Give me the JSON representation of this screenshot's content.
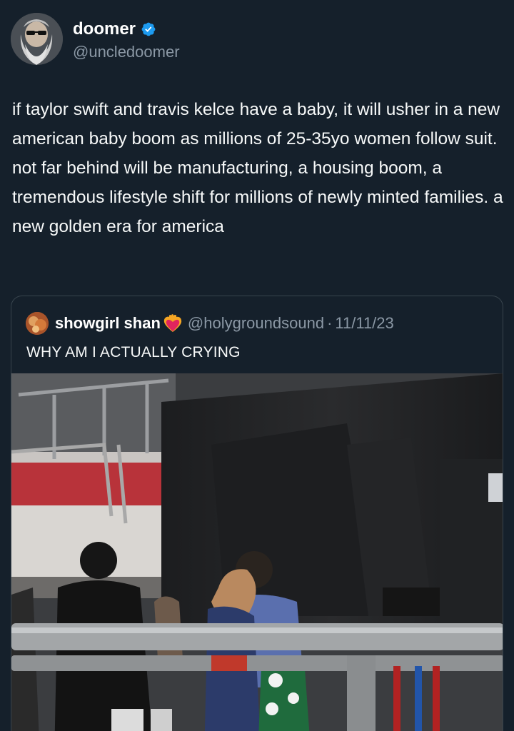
{
  "tweet": {
    "author": {
      "display_name": "doomer",
      "handle": "@uncledoomer",
      "verified": true,
      "verified_color": "#1d9bf0"
    },
    "text": "if taylor swift and travis kelce have a baby, it will usher in a new american baby boom as millions of 25-35yo women follow suit. not far behind will be manufacturing, a housing boom, a tremendous lifestyle shift for millions of newly minted families. a new golden era for america"
  },
  "quote": {
    "display_name": "showgirl shan",
    "name_emoji": "heart-on-fire-icon",
    "handle": "@holygroundsound",
    "separator": "·",
    "date": "11/11/23",
    "text": "WHY AM I ACTUALLY CRYING",
    "media_icon": "photo-icon"
  },
  "theme": {
    "background": "#15202b",
    "secondary_text": "#8b98a5",
    "border": "#38444d"
  }
}
